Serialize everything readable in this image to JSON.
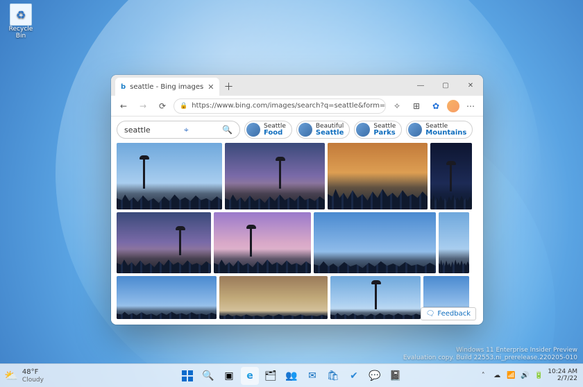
{
  "desktop": {
    "recycle_bin_label": "Recycle Bin",
    "watermark_line1": "Windows 11 Enterprise Insider Preview",
    "watermark_line2": "Evaluation copy. Build 22553.ni_prerelease.220205-010"
  },
  "browser": {
    "tab_title": "seattle - Bing images",
    "url": "https://www.bing.com/images/search?q=seattle&form=HDRSC3&first=1&tsc=ImageBasic...",
    "search_query": "seattle",
    "chips": [
      {
        "line1": "Seattle",
        "line2": "Food"
      },
      {
        "line1": "Beautiful",
        "line2": "Seattle"
      },
      {
        "line1": "Seattle",
        "line2": "Parks"
      },
      {
        "line1": "Seattle",
        "line2": "Mountains"
      }
    ],
    "feedback_label": "Feedback"
  },
  "taskbar": {
    "weather_temp": "48°F",
    "weather_cond": "Cloudy",
    "time": "10:24 AM",
    "date": "2/7/22"
  }
}
